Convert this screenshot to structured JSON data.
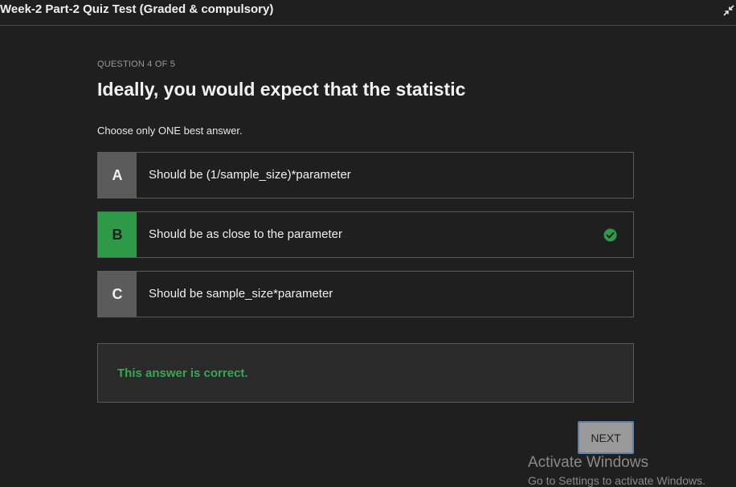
{
  "header": {
    "title": "Week-2 Part-2 Quiz Test (Graded & compulsory)",
    "expand_icon": "collapse-arrows-icon"
  },
  "question": {
    "number_label": "QUESTION 4 OF 5",
    "text": "Ideally, you would expect that the statistic",
    "instruction": "Choose only ONE best answer."
  },
  "options": [
    {
      "letter": "A",
      "text": "Should be (1/sample_size)*parameter",
      "selected": false
    },
    {
      "letter": "B",
      "text": "Should be as close to the parameter",
      "selected": true,
      "status_icon": "check-circle-icon"
    },
    {
      "letter": "C",
      "text": "Should be sample_size*parameter",
      "selected": false
    }
  ],
  "feedback": {
    "text": "This answer is correct."
  },
  "navigation": {
    "next_label": "NEXT"
  },
  "watermark": {
    "line1": "Activate Windows",
    "line2": "Go to Settings to activate Windows."
  },
  "colors": {
    "background": "#1f1f1f",
    "correct_green": "#2e9a48",
    "feedback_text": "#3aa655",
    "option_letter_bg": "#5b5b5b"
  }
}
